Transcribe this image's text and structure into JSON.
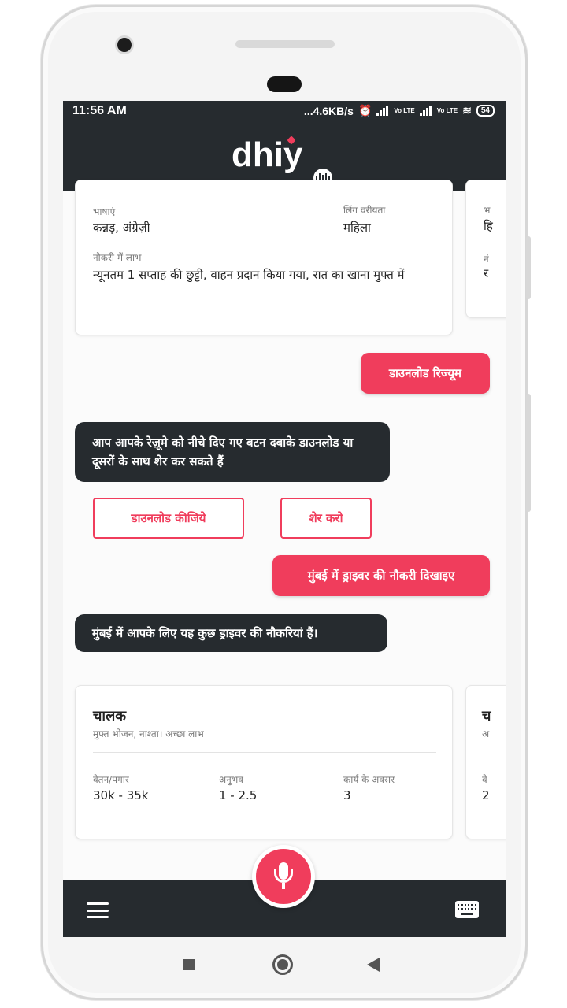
{
  "status": {
    "time": "11:56 AM",
    "network_speed": "...4.6KB/s",
    "lte1": "Vo LTE",
    "lte2": "Vo LTE",
    "battery": "54"
  },
  "header": {
    "logo": "dhiy"
  },
  "profile_card": {
    "languages_label": "भाषाएं",
    "languages_value": "कन्नड़, अंग्रेज़ी",
    "gender_label": "लिंग वरीयता",
    "gender_value": "महिला",
    "benefits_label": "नौकरी में लाभ",
    "benefits_value": "न्यूनतम 1 सप्ताह की छुट्टी, वाहन प्रदान किया गया, रात का खाना मुफ्त में",
    "peek_letter1": "भ",
    "peek_letter2": "हि",
    "peek_letter3": "नं",
    "peek_letter4": "र"
  },
  "chat": {
    "user_msg_1": "डाउनलोड रिज्यूम",
    "bot_msg_1": "आप आपके रेज़ूमे  को नीचे दिए गए बटन दबाके डाउनलोड या दूसरों के साथ शेर कर सकते हैं",
    "download_btn": "डाउनलोड कीजिये",
    "share_btn": "शेर करो",
    "user_msg_2": "मुंबई में ड्राइवर की नौकरी दिखाइए",
    "bot_msg_2": "मुंबई में आपके लिए यह कुछ ड्राइवर की नौकरियां हैं।"
  },
  "job_card": {
    "title": "चालक",
    "subtitle": "मुफ्त भोजन, नाश्ता। अच्छा लाभ",
    "salary_label": "वेतन/पगार",
    "salary_value": "30k - 35k",
    "experience_label": "अनुभव",
    "experience_value": "1 - 2.5",
    "openings_label": "कार्य के अवसर",
    "openings_value": "3",
    "peek_title": "च",
    "peek_sub": "अ",
    "peek_label": "वे",
    "peek_value": "2"
  },
  "colors": {
    "accent": "#f03d5c",
    "dark": "#262b2f"
  }
}
